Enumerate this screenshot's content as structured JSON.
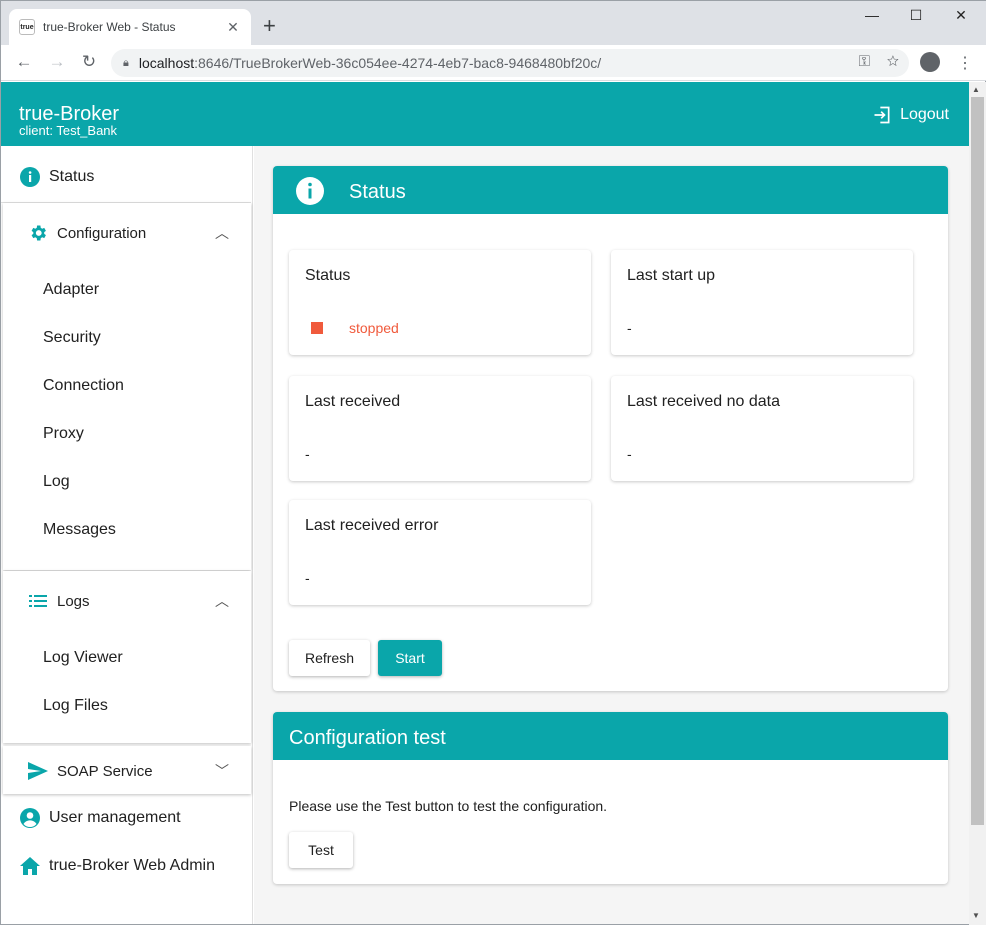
{
  "browser": {
    "tab_title": "true-Broker Web - Status",
    "favicon_text": "true",
    "tab_close": "✕",
    "new_tab": "+",
    "url_host": "localhost",
    "url_rest": ":8646/TrueBrokerWeb-36c054ee-4274-4eb7-bac8-9468480bf20c/",
    "window_controls": {
      "minimize": "—",
      "maximize": "☐",
      "close": "✕"
    }
  },
  "header": {
    "title": "true-Broker",
    "subtitle": "client: Test_Bank",
    "logout_label": "Logout"
  },
  "sidebar": {
    "status": "Status",
    "configuration": {
      "label": "Configuration",
      "items": [
        "Adapter",
        "Security",
        "Connection",
        "Proxy",
        "Log",
        "Messages"
      ]
    },
    "logs": {
      "label": "Logs",
      "items": [
        "Log Viewer",
        "Log Files"
      ]
    },
    "soap": "SOAP Service",
    "user_management": "User management",
    "admin": "true-Broker Web Admin"
  },
  "status_card": {
    "title": "Status",
    "boxes": [
      {
        "title": "Status",
        "value": "stopped"
      },
      {
        "title": "Last start up",
        "value": "-"
      },
      {
        "title": "Last received",
        "value": "-"
      },
      {
        "title": "Last received no data",
        "value": "-"
      },
      {
        "title": "Last received error",
        "value": "-"
      }
    ],
    "refresh_label": "Refresh",
    "start_label": "Start"
  },
  "config_test": {
    "title": "Configuration test",
    "description": "Please use the Test button to test the configuration.",
    "test_label": "Test"
  },
  "colors": {
    "primary": "#0aa6aa",
    "stopped": "#f05a3c"
  }
}
